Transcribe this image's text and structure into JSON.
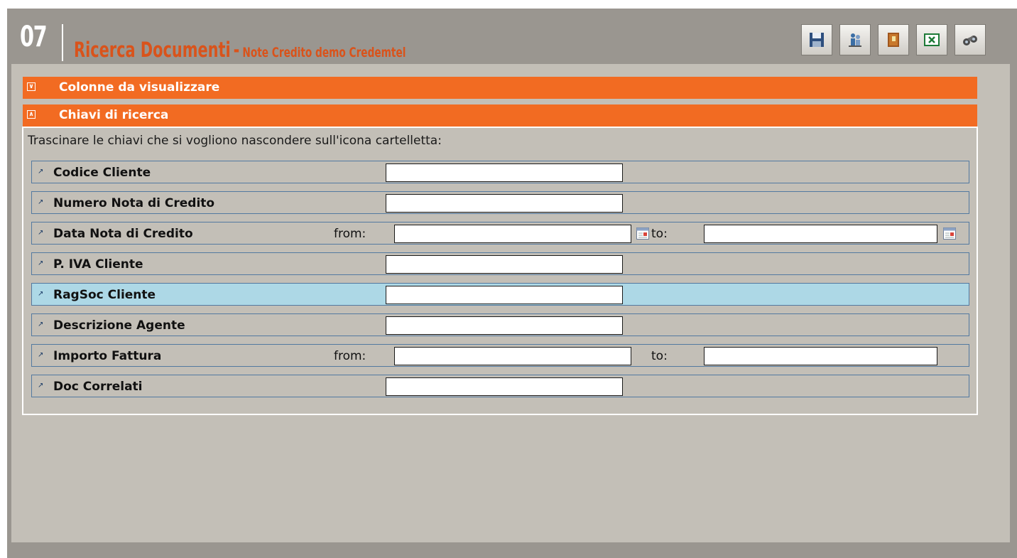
{
  "header": {
    "page_number": "07",
    "title": "Ricerca Documenti",
    "separator": "-",
    "subtitle": "Note Credito demo Credemtel"
  },
  "toolbar": {
    "buttons": [
      {
        "name": "save-icon"
      },
      {
        "name": "users-icon"
      },
      {
        "name": "folder-icon"
      },
      {
        "name": "excel-icon"
      },
      {
        "name": "binoculars-icon"
      }
    ]
  },
  "sections": {
    "columns": {
      "label": "Colonne da visualizzare",
      "state": "collapsed"
    },
    "search_keys": {
      "label": "Chiavi di ricerca",
      "state": "expanded"
    }
  },
  "instruction": "Trascinare le chiavi che si vogliono nascondere sull'icona cartelletta:",
  "keys": [
    {
      "label": "Codice Cliente",
      "type": "single",
      "value": ""
    },
    {
      "label": "Numero Nota di Credito",
      "type": "single",
      "value": ""
    },
    {
      "label": "Data Nota di Credito",
      "type": "date-range",
      "from_label": "from:",
      "to_label": "to:",
      "from_value": "",
      "to_value": ""
    },
    {
      "label": "P. IVA Cliente",
      "type": "single",
      "value": ""
    },
    {
      "label": "RagSoc Cliente",
      "type": "single",
      "value": "",
      "highlighted": true
    },
    {
      "label": "Descrizione Agente",
      "type": "single",
      "value": ""
    },
    {
      "label": "Importo Fattura",
      "type": "range",
      "from_label": "from:",
      "to_label": "to:",
      "from_value": "",
      "to_value": ""
    },
    {
      "label": "Doc Correlati",
      "type": "single",
      "value": ""
    }
  ],
  "colors": {
    "accent_orange": "#f26b22",
    "title_orange": "#d9531b",
    "panel_bg": "#c3bfb7",
    "frame_bg": "#9a9690",
    "highlight_row": "#add8e6",
    "row_border": "#5379a0"
  }
}
